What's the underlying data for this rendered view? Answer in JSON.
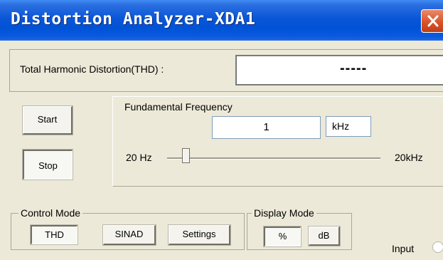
{
  "window": {
    "title": "Distortion Analyzer-XDA1",
    "close_icon": "close-icon"
  },
  "thd": {
    "label": "Total Harmonic Distortion(THD) :",
    "value": "-----"
  },
  "buttons": {
    "start": "Start",
    "stop": "Stop"
  },
  "frequency": {
    "title": "Fundamental Frequency",
    "value": "1",
    "unit": "kHz",
    "slider_min": "20 Hz",
    "slider_max": "20kHz"
  },
  "control_mode": {
    "legend": "Control Mode",
    "thd": "THD",
    "sinad": "SINAD",
    "settings": "Settings",
    "selected": "THD"
  },
  "display_mode": {
    "legend": "Display Mode",
    "percent": "%",
    "db": "dB",
    "selected": "%"
  },
  "input": {
    "label": "Input"
  },
  "colors": {
    "titlebar": "#0052d6",
    "close": "#d8542b",
    "panel": "#ece9d8"
  }
}
